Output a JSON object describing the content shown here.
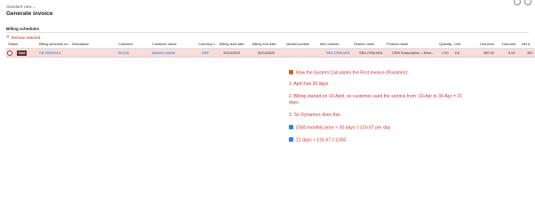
{
  "header": {
    "view_label": "Standard view",
    "page_title": "Generate invoice"
  },
  "section": {
    "title": "Billing schedules",
    "remove_selected": "Remove selected"
  },
  "table": {
    "columns": [
      "Status",
      "Billing schedule nu...",
      "Description",
      "Customer",
      "Customer name",
      "Currency c...",
      "Billing start date",
      "Billing end date",
      "Variant number",
      "Item number",
      "Search name",
      "Product name",
      "Quantity",
      "Unit",
      "Unit price",
      "Discount",
      "Net a"
    ],
    "row": {
      "status": "Void",
      "schedule_number": "CB-00000014",
      "description": "",
      "customer": "001116",
      "customer_name": "#####ü Ltd###",
      "currency": "GBP",
      "start_date": "10/04/2025",
      "end_date": "30/04/2025",
      "variant": "",
      "item_number": "SBX-CRM-M01",
      "search_name": "SBX-CRM-M01",
      "product_name": "CRM Subscription – Mont...",
      "quantity": "1.00",
      "unit": "EA",
      "unit_price": "350.00",
      "discount": "0.00",
      "net": "350"
    }
  },
  "annotation": {
    "heading": "How the System Calculates the First Invoice (Proration):",
    "line1": "1. April has 30 days",
    "line2a": "2. Billing started on 10-April, so customer used the service from: 10-Apr to 30-Apr = 21",
    "line2b": "days",
    "line3": "3. So Dynamics does this:",
    "calc1": "£500 monthly price ÷ 30 days = £16.67 per day",
    "calc2": "21 days × £16.67 = £350"
  },
  "icons": {
    "heading": "book-icon",
    "calc": "checkbox-icon"
  },
  "colors": {
    "annotation_text": "#d13438",
    "selected_row": "#f6dcdd",
    "link": "#0078d4",
    "status_badge": "#5c2a1f"
  }
}
